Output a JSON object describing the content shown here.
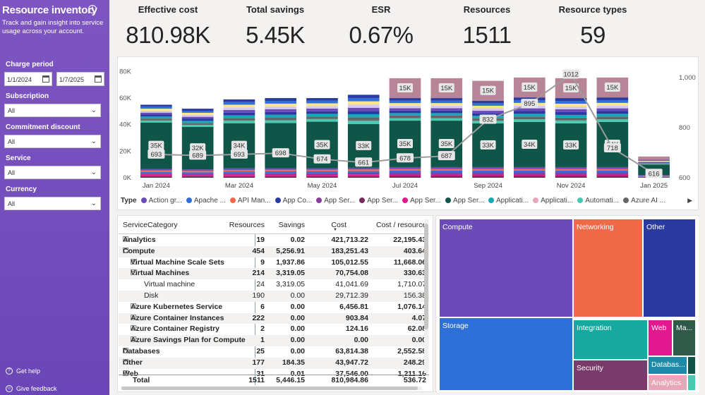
{
  "sidebar": {
    "title": "Resource inventory",
    "info_glyph": "i",
    "subtitle": "Track and gain insight into service usage across your account.",
    "charge_period": {
      "label": "Charge period",
      "start": "1/1/2024",
      "end": "1/7/2025"
    },
    "subscription": {
      "label": "Subscription",
      "value": "All"
    },
    "commitment_discount": {
      "label": "Commitment discount",
      "value": "All"
    },
    "service": {
      "label": "Service",
      "value": "All"
    },
    "currency": {
      "label": "Currency",
      "value": "All"
    },
    "help": "Get help",
    "feedback": "Give feedback"
  },
  "kpis": [
    {
      "label": "Effective cost",
      "value": "810.98K"
    },
    {
      "label": "Total savings",
      "value": "5.45K"
    },
    {
      "label": "ESR",
      "value": "0.67%"
    },
    {
      "label": "Resources",
      "value": "1511"
    },
    {
      "label": "Resource types",
      "value": "59"
    }
  ],
  "legend": {
    "title": "Type",
    "items": [
      {
        "label": "Action gr...",
        "color": "#6b4bb8"
      },
      {
        "label": "Apache ...",
        "color": "#2f6fd8"
      },
      {
        "label": "API Man...",
        "color": "#f06a4a"
      },
      {
        "label": "App Co...",
        "color": "#2b3aa0"
      },
      {
        "label": "App Ser...",
        "color": "#8a3c9e"
      },
      {
        "label": "App Ser...",
        "color": "#7a2a5a"
      },
      {
        "label": "App Ser...",
        "color": "#e3188f"
      },
      {
        "label": "App Ser...",
        "color": "#0f5648"
      },
      {
        "label": "Applicati...",
        "color": "#17a8b8"
      },
      {
        "label": "Applicati...",
        "color": "#e8a7b8"
      },
      {
        "label": "Automati...",
        "color": "#49c9b0"
      },
      {
        "label": "Azure AI ...",
        "color": "#666666"
      }
    ],
    "more_glyph": "▶"
  },
  "chart_data": {
    "type": "bar",
    "categories": [
      "Jan 2024",
      "Feb 2024",
      "Mar 2024",
      "Apr 2024",
      "May 2024",
      "Jun 2024",
      "Jul 2024",
      "Aug 2024",
      "Sep 2024",
      "Oct 2024",
      "Nov 2024",
      "Dec 2024",
      "Jan 2025"
    ],
    "x_tick_labels": [
      "Jan 2024",
      "Mar 2024",
      "May 2024",
      "Jul 2024",
      "Sep 2024",
      "Nov 2024",
      "Jan 2025"
    ],
    "ylim": [
      0,
      85000
    ],
    "y_ticks": [
      "0K",
      "20K",
      "40K",
      "60K",
      "80K"
    ],
    "y2lim": [
      600,
      1050
    ],
    "y2_ticks": [
      "600",
      "800",
      "1,000"
    ],
    "bar_totals": [
      55000,
      52000,
      59000,
      60000,
      60000,
      62500,
      75000,
      75000,
      73000,
      75500,
      75000,
      75500,
      16000
    ],
    "dark_segment": [
      35000,
      32000,
      34000,
      34000,
      35000,
      33000,
      35000,
      35000,
      33000,
      34000,
      33000,
      34000,
      8000
    ],
    "dark_segment_labels": [
      "35K",
      "32K",
      "34K",
      "",
      "35K",
      "33K",
      "35K",
      "35K",
      "33K",
      "34K",
      "33K",
      "34K",
      ""
    ],
    "top_segment_labels": [
      "",
      "",
      "",
      "",
      "",
      "",
      "15K",
      "15K",
      "15K",
      "15K",
      "15K",
      "15K",
      ""
    ],
    "line_series": {
      "name": "Resources",
      "values": [
        693,
        689,
        693,
        698,
        674,
        661,
        678,
        687,
        832,
        895,
        1012,
        718,
        616
      ],
      "labels": [
        "693",
        "689",
        "693",
        "698",
        "674",
        "661",
        "678",
        "687",
        "832",
        "895",
        "1012",
        "718",
        "616"
      ]
    },
    "extra_label": {
      "month_index": 10,
      "text": "15K"
    }
  },
  "table": {
    "headers": [
      "ServiceCategory",
      "Resources",
      "Savings",
      "Cost",
      "Cost / resource"
    ],
    "rows": [
      {
        "name": "Analytics",
        "level": 0,
        "exp": "+",
        "bold": true,
        "v": [
          "19",
          "0.02",
          "421,713.22",
          "22,195.43"
        ]
      },
      {
        "name": "Compute",
        "level": 0,
        "exp": "−",
        "bold": true,
        "v": [
          "454",
          "5,256.91",
          "183,251.43",
          "403.64"
        ]
      },
      {
        "name": "Virtual Machine Scale Sets",
        "level": 1,
        "exp": "+",
        "bold": true,
        "v": [
          "9",
          "1,937.86",
          "105,012.55",
          "11,668.06"
        ]
      },
      {
        "name": "Virtual Machines",
        "level": 1,
        "exp": "−",
        "bold": true,
        "v": [
          "214",
          "3,319.05",
          "70,754.08",
          "330.63"
        ]
      },
      {
        "name": "Virtual machine",
        "level": 2,
        "exp": "",
        "bold": false,
        "v": [
          "24",
          "3,319.05",
          "41,041.69",
          "1,710.07"
        ]
      },
      {
        "name": "Disk",
        "level": 2,
        "exp": "",
        "bold": false,
        "v": [
          "190",
          "0.00",
          "29,712.39",
          "156.38"
        ]
      },
      {
        "name": "Azure Kubernetes Service",
        "level": 1,
        "exp": "+",
        "bold": true,
        "v": [
          "6",
          "0.00",
          "6,456.81",
          "1,076.14"
        ]
      },
      {
        "name": "Azure Container Instances",
        "level": 1,
        "exp": "+",
        "bold": true,
        "v": [
          "222",
          "0.00",
          "903.84",
          "4.07"
        ]
      },
      {
        "name": "Azure Container Registry",
        "level": 1,
        "exp": "+",
        "bold": true,
        "v": [
          "2",
          "0.00",
          "124.16",
          "62.08"
        ]
      },
      {
        "name": "Azure Savings Plan for Compute",
        "level": 1,
        "exp": "+",
        "bold": true,
        "v": [
          "1",
          "0.00",
          "0.00",
          "0.00"
        ]
      },
      {
        "name": "Databases",
        "level": 0,
        "exp": "+",
        "bold": true,
        "v": [
          "25",
          "0.00",
          "63,814.38",
          "2,552.58"
        ]
      },
      {
        "name": "Other",
        "level": 0,
        "exp": "+",
        "bold": true,
        "v": [
          "177",
          "184.35",
          "43,947.72",
          "248.29"
        ]
      },
      {
        "name": "Web",
        "level": 0,
        "exp": "+",
        "bold": true,
        "v": [
          "31",
          "0.01",
          "37,546.00",
          "1,211.16"
        ]
      }
    ],
    "total": {
      "name": "Total",
      "v": [
        "1511",
        "5,446.15",
        "810,984.86",
        "536.72"
      ]
    }
  },
  "treemap": {
    "cells": [
      {
        "label": "Compute",
        "color": "#6b4bb8"
      },
      {
        "label": "Networking",
        "color": "#f06a4a"
      },
      {
        "label": "Other",
        "color": "#2b3aa0"
      },
      {
        "label": "Storage",
        "color": "#2f6fd8"
      },
      {
        "label": "Integration",
        "color": "#17a8a0"
      },
      {
        "label": "Web",
        "color": "#e3188f"
      },
      {
        "label": "Ma...",
        "color": "#2f5a4a"
      },
      {
        "label": "Security",
        "color": "#7a3a6a"
      },
      {
        "label": "Databas...",
        "color": "#1f8aa8"
      },
      {
        "label": "Analytics",
        "color": "#e8a7b8"
      }
    ]
  }
}
